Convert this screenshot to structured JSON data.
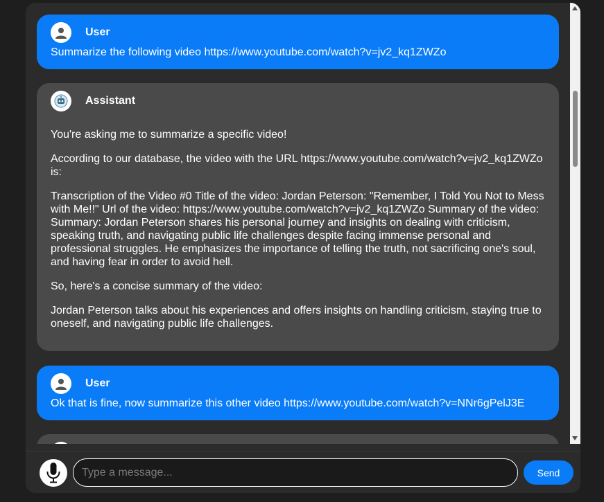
{
  "messages": [
    {
      "role": "user",
      "sender": "User",
      "paragraphs": [
        "Summarize the following video https://www.youtube.com/watch?v=jv2_kq1ZWZo"
      ]
    },
    {
      "role": "assistant",
      "sender": "Assistant",
      "paragraphs": [
        "You're asking me to summarize a specific video!",
        "According to our database, the video with the URL https://www.youtube.com/watch?v=jv2_kq1ZWZo is:",
        "Transcription of the Video #0 Title of the video: Jordan Peterson: \"Remember, I Told You Not to Mess with Me!!\" Url of the video: https://www.youtube.com/watch?v=jv2_kq1ZWZo Summary of the video: Summary: Jordan Peterson shares his personal journey and insights on dealing with criticism, speaking truth, and navigating public life challenges despite facing immense personal and professional struggles. He emphasizes the importance of telling the truth, not sacrificing one's soul, and having fear in order to avoid hell.",
        "So, here's a concise summary of the video:",
        "Jordan Peterson talks about his experiences and offers insights on handling criticism, staying true to oneself, and navigating public life challenges."
      ]
    },
    {
      "role": "user",
      "sender": "User",
      "paragraphs": [
        "Ok that is fine, now summarize this other video https://www.youtube.com/watch?v=NNr6gPelJ3E"
      ]
    }
  ],
  "input": {
    "placeholder": "Type a message...",
    "value": ""
  },
  "send_label": "Send",
  "icons": {
    "user_avatar": "user-icon",
    "assistant_avatar": "bot-icon",
    "mic": "microphone-icon"
  },
  "colors": {
    "user_bubble": "#0a7cf8",
    "assistant_bubble": "#4a4a4a",
    "background": "#2b2b2b",
    "send": "#0a7cf8"
  }
}
